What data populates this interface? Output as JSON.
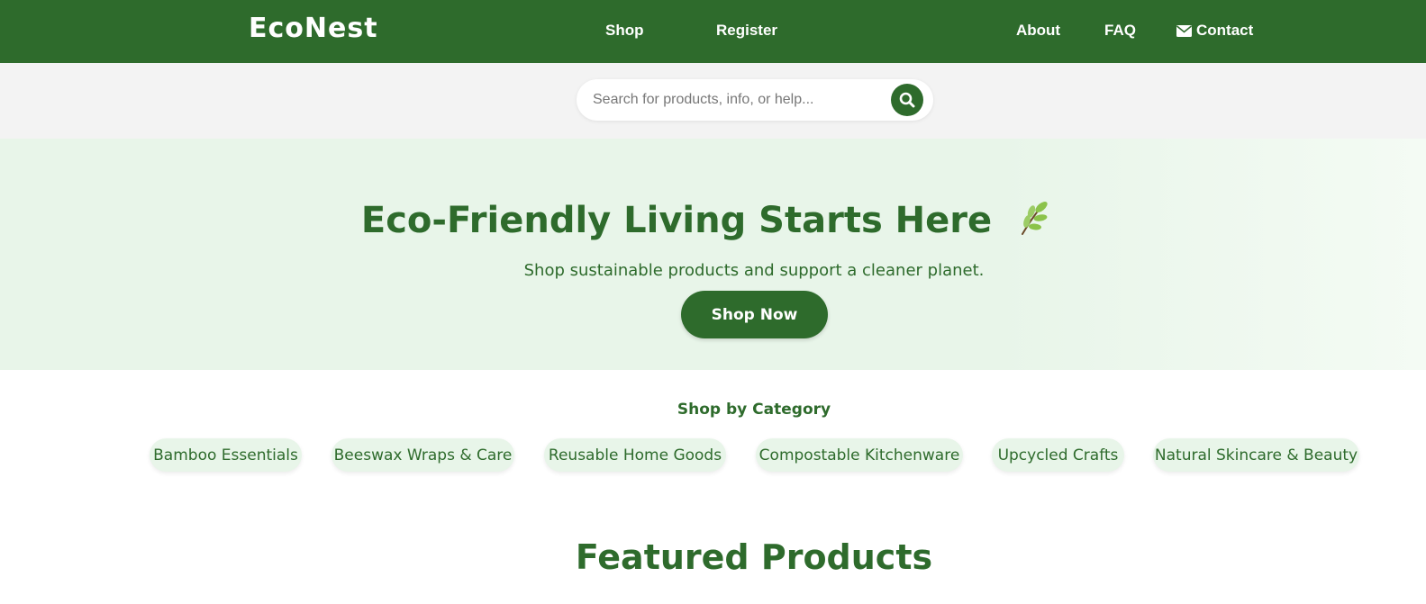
{
  "header": {
    "logo": "EcoNest",
    "nav": {
      "shop": "Shop",
      "register": "Register",
      "about": "About",
      "faq": "FAQ",
      "contact": "Contact"
    }
  },
  "search": {
    "placeholder": "Search for products, info, or help...",
    "value": ""
  },
  "hero": {
    "title": "Eco-Friendly Living Starts Here",
    "icon": "leaf-icon",
    "subtitle": "Shop sustainable products and support a cleaner planet.",
    "cta": "Shop Now"
  },
  "categories": {
    "title": "Shop by Category",
    "items": [
      "Bamboo Essentials",
      "Beeswax Wraps & Care",
      "Reusable Home Goods",
      "Compostable Kitchenware",
      "Upcycled Crafts",
      "Natural Skincare & Beauty"
    ]
  },
  "featured": {
    "title": "Featured Products"
  },
  "colors": {
    "brand": "#2e6b2c",
    "hero_bg": "#e8f5e9",
    "search_band": "#f3f3f3"
  }
}
